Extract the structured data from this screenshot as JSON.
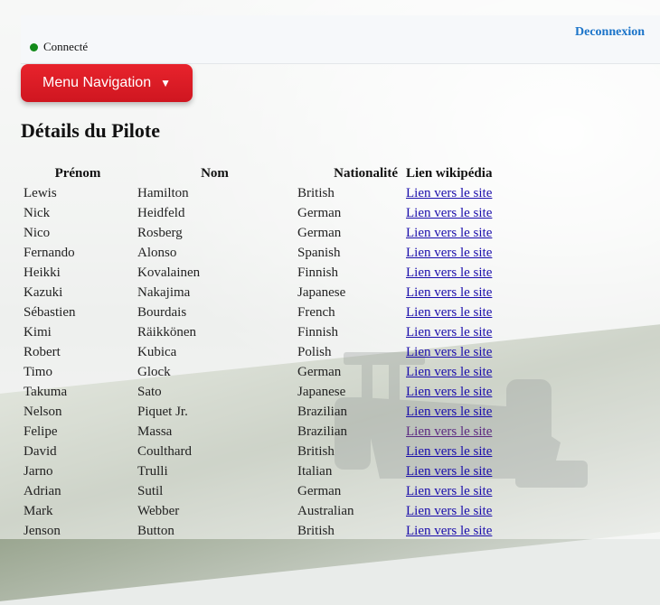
{
  "header": {
    "logout_label": "Deconnexion",
    "status_label": "Connecté",
    "status_color": "#138a1a"
  },
  "menu": {
    "label": "Menu Navigation",
    "caret": "▼",
    "color": "#e8232c"
  },
  "page_title": "Détails du Pilote",
  "table": {
    "headers": [
      "Prénom",
      "Nom",
      "Nationalité",
      "Lien wikipédia"
    ],
    "link_label": "Lien vers le site",
    "rows": [
      {
        "first": "Lewis",
        "last": "Hamilton",
        "nationality": "British"
      },
      {
        "first": "Nick",
        "last": "Heidfeld",
        "nationality": "German"
      },
      {
        "first": "Nico",
        "last": "Rosberg",
        "nationality": "German"
      },
      {
        "first": "Fernando",
        "last": "Alonso",
        "nationality": "Spanish"
      },
      {
        "first": "Heikki",
        "last": "Kovalainen",
        "nationality": "Finnish"
      },
      {
        "first": "Kazuki",
        "last": "Nakajima",
        "nationality": "Japanese"
      },
      {
        "first": "Sébastien",
        "last": "Bourdais",
        "nationality": "French"
      },
      {
        "first": "Kimi",
        "last": "Räikkönen",
        "nationality": "Finnish"
      },
      {
        "first": "Robert",
        "last": "Kubica",
        "nationality": "Polish"
      },
      {
        "first": "Timo",
        "last": "Glock",
        "nationality": "German"
      },
      {
        "first": "Takuma",
        "last": "Sato",
        "nationality": "Japanese"
      },
      {
        "first": "Nelson",
        "last": "Piquet Jr.",
        "nationality": "Brazilian"
      },
      {
        "first": "Felipe",
        "last": "Massa",
        "nationality": "Brazilian",
        "visited": true
      },
      {
        "first": "David",
        "last": "Coulthard",
        "nationality": "British"
      },
      {
        "first": "Jarno",
        "last": "Trulli",
        "nationality": "Italian"
      },
      {
        "first": "Adrian",
        "last": "Sutil",
        "nationality": "German"
      },
      {
        "first": "Mark",
        "last": "Webber",
        "nationality": "Australian"
      },
      {
        "first": "Jenson",
        "last": "Button",
        "nationality": "British"
      }
    ]
  }
}
